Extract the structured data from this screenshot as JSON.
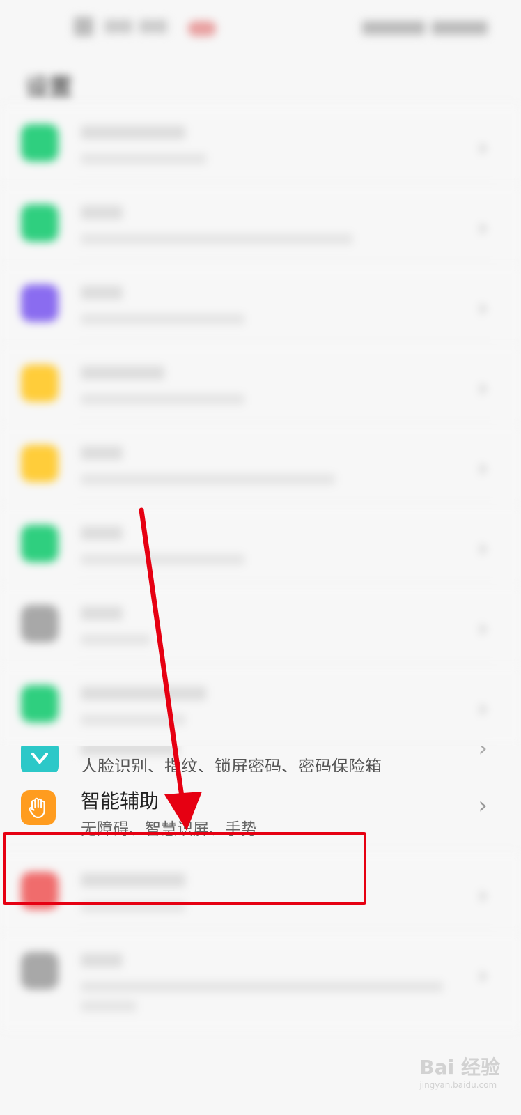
{
  "header": {
    "title": "设置"
  },
  "status_bar": {
    "left_icons": [
      "carrier-icon",
      "signal-icon",
      "wifi-icon",
      "notification-icon"
    ],
    "right_icons": [
      "battery-icon",
      "time"
    ]
  },
  "list": {
    "items": [
      {
        "icon": "desktop-icon",
        "color": "#2fcf7f",
        "title": "",
        "subtitle": ""
      },
      {
        "icon": "display-icon",
        "color": "#2fcf7f",
        "title": "",
        "subtitle": ""
      },
      {
        "icon": "sound-icon",
        "color": "#8a6cf0",
        "title": "",
        "subtitle": ""
      },
      {
        "icon": "notification-center-icon",
        "color": "#ffcd3a",
        "title": "",
        "subtitle": ""
      },
      {
        "icon": "apps-icon",
        "color": "#ffcd3a",
        "title": "",
        "subtitle": ""
      },
      {
        "icon": "battery-icon",
        "color": "#2fcf7f",
        "title": "",
        "subtitle": ""
      },
      {
        "icon": "storage-icon",
        "color": "#a8a8a8",
        "title": "",
        "subtitle": ""
      },
      {
        "icon": "digital-balance-icon",
        "color": "#2fcf7f",
        "title": "",
        "subtitle": ""
      },
      {
        "icon": "security-icon",
        "color": "#2cc8c8",
        "title": "",
        "subtitle": "人脸识别、指纹、锁屏密码、密码保险箱"
      },
      {
        "icon": "hand-icon",
        "color": "#ff9c1f",
        "title": "智能辅助",
        "subtitle": "无障碍、智慧识屏、手势"
      },
      {
        "icon": "users-icon",
        "color": "#f06c6c",
        "title": "",
        "subtitle": ""
      },
      {
        "icon": "system-icon",
        "color": "#a8a8a8",
        "title": "",
        "subtitle": ""
      }
    ]
  },
  "annotation": {
    "highlight_color": "#e60012",
    "arrow_color": "#e60012"
  },
  "watermark": {
    "text": "Bai 经验",
    "domain": "jingyan.baidu.com"
  }
}
